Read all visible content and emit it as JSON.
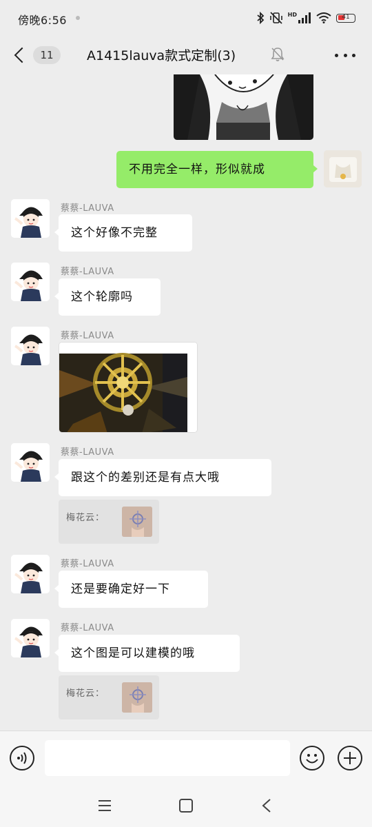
{
  "status_bar": {
    "time": "傍晚6:56",
    "network_label": "HD",
    "battery_text": "41",
    "battery_level": 0.41,
    "battery_color": "#e33333"
  },
  "nav": {
    "unread_count": "11",
    "title": "A1415lauva款式定制(3)",
    "icons": [
      "chevron-left",
      "bell-muted",
      "more-dots"
    ]
  },
  "messages": [
    {
      "type": "image",
      "side": "right",
      "description_icon": "cartoon-sketch"
    },
    {
      "type": "text",
      "side": "right",
      "text": "不用完全一样，形似就成"
    },
    {
      "type": "text",
      "side": "left",
      "sender": "蔡蔡-LAUVA",
      "text": "这个好像不完整"
    },
    {
      "type": "text",
      "side": "left",
      "sender": "蔡蔡-LAUVA",
      "text": "这个轮廓吗"
    },
    {
      "type": "image",
      "side": "left",
      "sender": "蔡蔡-LAUVA",
      "description_icon": "golden-sun-emblem"
    },
    {
      "type": "text",
      "side": "left",
      "sender": "蔡蔡-LAUVA",
      "text": "跟这个的差别还是有点大哦"
    },
    {
      "type": "quote",
      "text": "梅花云："
    },
    {
      "type": "text",
      "side": "left",
      "sender": "蔡蔡-LAUVA",
      "text": "还是要确定好一下"
    },
    {
      "type": "text",
      "side": "left",
      "sender": "蔡蔡-LAUVA",
      "text": "这个图是可以建模的哦"
    },
    {
      "type": "quote",
      "text": "梅花云："
    }
  ],
  "input_bar": {
    "input_value": "",
    "icons": [
      "voice-icon",
      "emoji-icon",
      "plus-icon"
    ]
  },
  "colors": {
    "sent_bubble": "#95ec69",
    "received_bubble": "#ffffff",
    "chat_background": "#ededed"
  }
}
